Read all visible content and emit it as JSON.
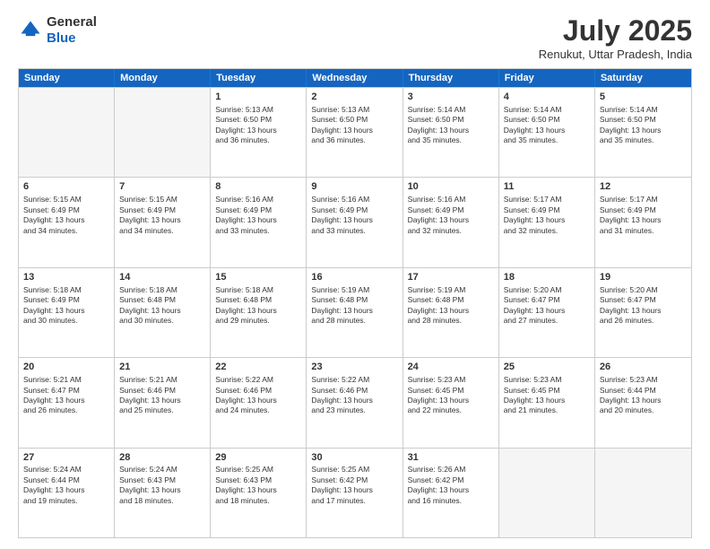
{
  "logo": {
    "general": "General",
    "blue": "Blue"
  },
  "title": {
    "month_year": "July 2025",
    "location": "Renukut, Uttar Pradesh, India"
  },
  "header_days": [
    "Sunday",
    "Monday",
    "Tuesday",
    "Wednesday",
    "Thursday",
    "Friday",
    "Saturday"
  ],
  "rows": [
    [
      {
        "day": "",
        "lines": []
      },
      {
        "day": "",
        "lines": []
      },
      {
        "day": "1",
        "lines": [
          "Sunrise: 5:13 AM",
          "Sunset: 6:50 PM",
          "Daylight: 13 hours",
          "and 36 minutes."
        ]
      },
      {
        "day": "2",
        "lines": [
          "Sunrise: 5:13 AM",
          "Sunset: 6:50 PM",
          "Daylight: 13 hours",
          "and 36 minutes."
        ]
      },
      {
        "day": "3",
        "lines": [
          "Sunrise: 5:14 AM",
          "Sunset: 6:50 PM",
          "Daylight: 13 hours",
          "and 35 minutes."
        ]
      },
      {
        "day": "4",
        "lines": [
          "Sunrise: 5:14 AM",
          "Sunset: 6:50 PM",
          "Daylight: 13 hours",
          "and 35 minutes."
        ]
      },
      {
        "day": "5",
        "lines": [
          "Sunrise: 5:14 AM",
          "Sunset: 6:50 PM",
          "Daylight: 13 hours",
          "and 35 minutes."
        ]
      }
    ],
    [
      {
        "day": "6",
        "lines": [
          "Sunrise: 5:15 AM",
          "Sunset: 6:49 PM",
          "Daylight: 13 hours",
          "and 34 minutes."
        ]
      },
      {
        "day": "7",
        "lines": [
          "Sunrise: 5:15 AM",
          "Sunset: 6:49 PM",
          "Daylight: 13 hours",
          "and 34 minutes."
        ]
      },
      {
        "day": "8",
        "lines": [
          "Sunrise: 5:16 AM",
          "Sunset: 6:49 PM",
          "Daylight: 13 hours",
          "and 33 minutes."
        ]
      },
      {
        "day": "9",
        "lines": [
          "Sunrise: 5:16 AM",
          "Sunset: 6:49 PM",
          "Daylight: 13 hours",
          "and 33 minutes."
        ]
      },
      {
        "day": "10",
        "lines": [
          "Sunrise: 5:16 AM",
          "Sunset: 6:49 PM",
          "Daylight: 13 hours",
          "and 32 minutes."
        ]
      },
      {
        "day": "11",
        "lines": [
          "Sunrise: 5:17 AM",
          "Sunset: 6:49 PM",
          "Daylight: 13 hours",
          "and 32 minutes."
        ]
      },
      {
        "day": "12",
        "lines": [
          "Sunrise: 5:17 AM",
          "Sunset: 6:49 PM",
          "Daylight: 13 hours",
          "and 31 minutes."
        ]
      }
    ],
    [
      {
        "day": "13",
        "lines": [
          "Sunrise: 5:18 AM",
          "Sunset: 6:49 PM",
          "Daylight: 13 hours",
          "and 30 minutes."
        ]
      },
      {
        "day": "14",
        "lines": [
          "Sunrise: 5:18 AM",
          "Sunset: 6:48 PM",
          "Daylight: 13 hours",
          "and 30 minutes."
        ]
      },
      {
        "day": "15",
        "lines": [
          "Sunrise: 5:18 AM",
          "Sunset: 6:48 PM",
          "Daylight: 13 hours",
          "and 29 minutes."
        ]
      },
      {
        "day": "16",
        "lines": [
          "Sunrise: 5:19 AM",
          "Sunset: 6:48 PM",
          "Daylight: 13 hours",
          "and 28 minutes."
        ]
      },
      {
        "day": "17",
        "lines": [
          "Sunrise: 5:19 AM",
          "Sunset: 6:48 PM",
          "Daylight: 13 hours",
          "and 28 minutes."
        ]
      },
      {
        "day": "18",
        "lines": [
          "Sunrise: 5:20 AM",
          "Sunset: 6:47 PM",
          "Daylight: 13 hours",
          "and 27 minutes."
        ]
      },
      {
        "day": "19",
        "lines": [
          "Sunrise: 5:20 AM",
          "Sunset: 6:47 PM",
          "Daylight: 13 hours",
          "and 26 minutes."
        ]
      }
    ],
    [
      {
        "day": "20",
        "lines": [
          "Sunrise: 5:21 AM",
          "Sunset: 6:47 PM",
          "Daylight: 13 hours",
          "and 26 minutes."
        ]
      },
      {
        "day": "21",
        "lines": [
          "Sunrise: 5:21 AM",
          "Sunset: 6:46 PM",
          "Daylight: 13 hours",
          "and 25 minutes."
        ]
      },
      {
        "day": "22",
        "lines": [
          "Sunrise: 5:22 AM",
          "Sunset: 6:46 PM",
          "Daylight: 13 hours",
          "and 24 minutes."
        ]
      },
      {
        "day": "23",
        "lines": [
          "Sunrise: 5:22 AM",
          "Sunset: 6:46 PM",
          "Daylight: 13 hours",
          "and 23 minutes."
        ]
      },
      {
        "day": "24",
        "lines": [
          "Sunrise: 5:23 AM",
          "Sunset: 6:45 PM",
          "Daylight: 13 hours",
          "and 22 minutes."
        ]
      },
      {
        "day": "25",
        "lines": [
          "Sunrise: 5:23 AM",
          "Sunset: 6:45 PM",
          "Daylight: 13 hours",
          "and 21 minutes."
        ]
      },
      {
        "day": "26",
        "lines": [
          "Sunrise: 5:23 AM",
          "Sunset: 6:44 PM",
          "Daylight: 13 hours",
          "and 20 minutes."
        ]
      }
    ],
    [
      {
        "day": "27",
        "lines": [
          "Sunrise: 5:24 AM",
          "Sunset: 6:44 PM",
          "Daylight: 13 hours",
          "and 19 minutes."
        ]
      },
      {
        "day": "28",
        "lines": [
          "Sunrise: 5:24 AM",
          "Sunset: 6:43 PM",
          "Daylight: 13 hours",
          "and 18 minutes."
        ]
      },
      {
        "day": "29",
        "lines": [
          "Sunrise: 5:25 AM",
          "Sunset: 6:43 PM",
          "Daylight: 13 hours",
          "and 18 minutes."
        ]
      },
      {
        "day": "30",
        "lines": [
          "Sunrise: 5:25 AM",
          "Sunset: 6:42 PM",
          "Daylight: 13 hours",
          "and 17 minutes."
        ]
      },
      {
        "day": "31",
        "lines": [
          "Sunrise: 5:26 AM",
          "Sunset: 6:42 PM",
          "Daylight: 13 hours",
          "and 16 minutes."
        ]
      },
      {
        "day": "",
        "lines": []
      },
      {
        "day": "",
        "lines": []
      }
    ]
  ]
}
